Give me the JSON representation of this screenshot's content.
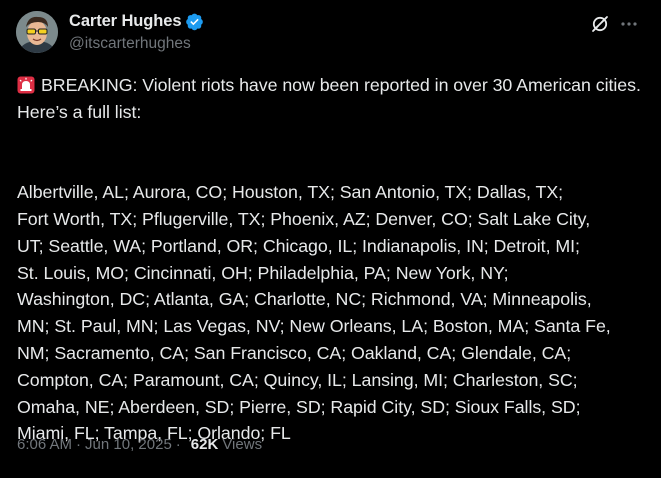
{
  "author": {
    "display_name": "Carter Hughes",
    "handle": "@itscarterhughes",
    "verified": true,
    "verified_color": "#1d9bf0"
  },
  "header_icons": {
    "grok": "grok-icon",
    "more": "more-icon"
  },
  "tweet": {
    "emoji": "siren-emoji",
    "headline": "BREAKING: Violent riots have now been reported in over 30 American cities. Here’s a full list:",
    "list_lines": [
      "Albertville, AL; Aurora, CO; Houston, TX; San Antonio, TX; Dallas, TX;",
      "Fort Worth, TX; Pflugerville, TX; Phoenix, AZ; Denver, CO; Salt Lake City,",
      "UT; Seattle, WA; Portland, OR; Chicago, IL; Indianapolis, IN; Detroit, MI;",
      "St. Louis, MO; Cincinnati, OH; Philadelphia, PA; New York, NY;",
      "Washington, DC; Atlanta, GA; Charlotte, NC; Richmond, VA; Minneapolis,",
      "MN; St. Paul, MN; Las Vegas, NV; New Orleans, LA; Boston, MA; Santa Fe,",
      "NM; Sacramento, CA; San Francisco, CA; Oakland, CA; Glendale, CA;",
      "Compton, CA; Paramount, CA; Quincy, IL; Lansing, MI; Charleston, SC;",
      "Omaha, NE; Aberdeen, SD; Pierre, SD; Rapid City, SD; Sioux Falls, SD;",
      "Miami, FL; Tampa, FL; Orlando; FL"
    ]
  },
  "meta": {
    "time": "6:06 AM",
    "separator": "·",
    "date": "Jun 10, 2025",
    "views_count": "62K",
    "views_label": "Views"
  },
  "colors": {
    "background": "#000000",
    "text_primary": "#e7e9ea",
    "text_secondary": "#71767b",
    "accent": "#1d9bf0"
  }
}
